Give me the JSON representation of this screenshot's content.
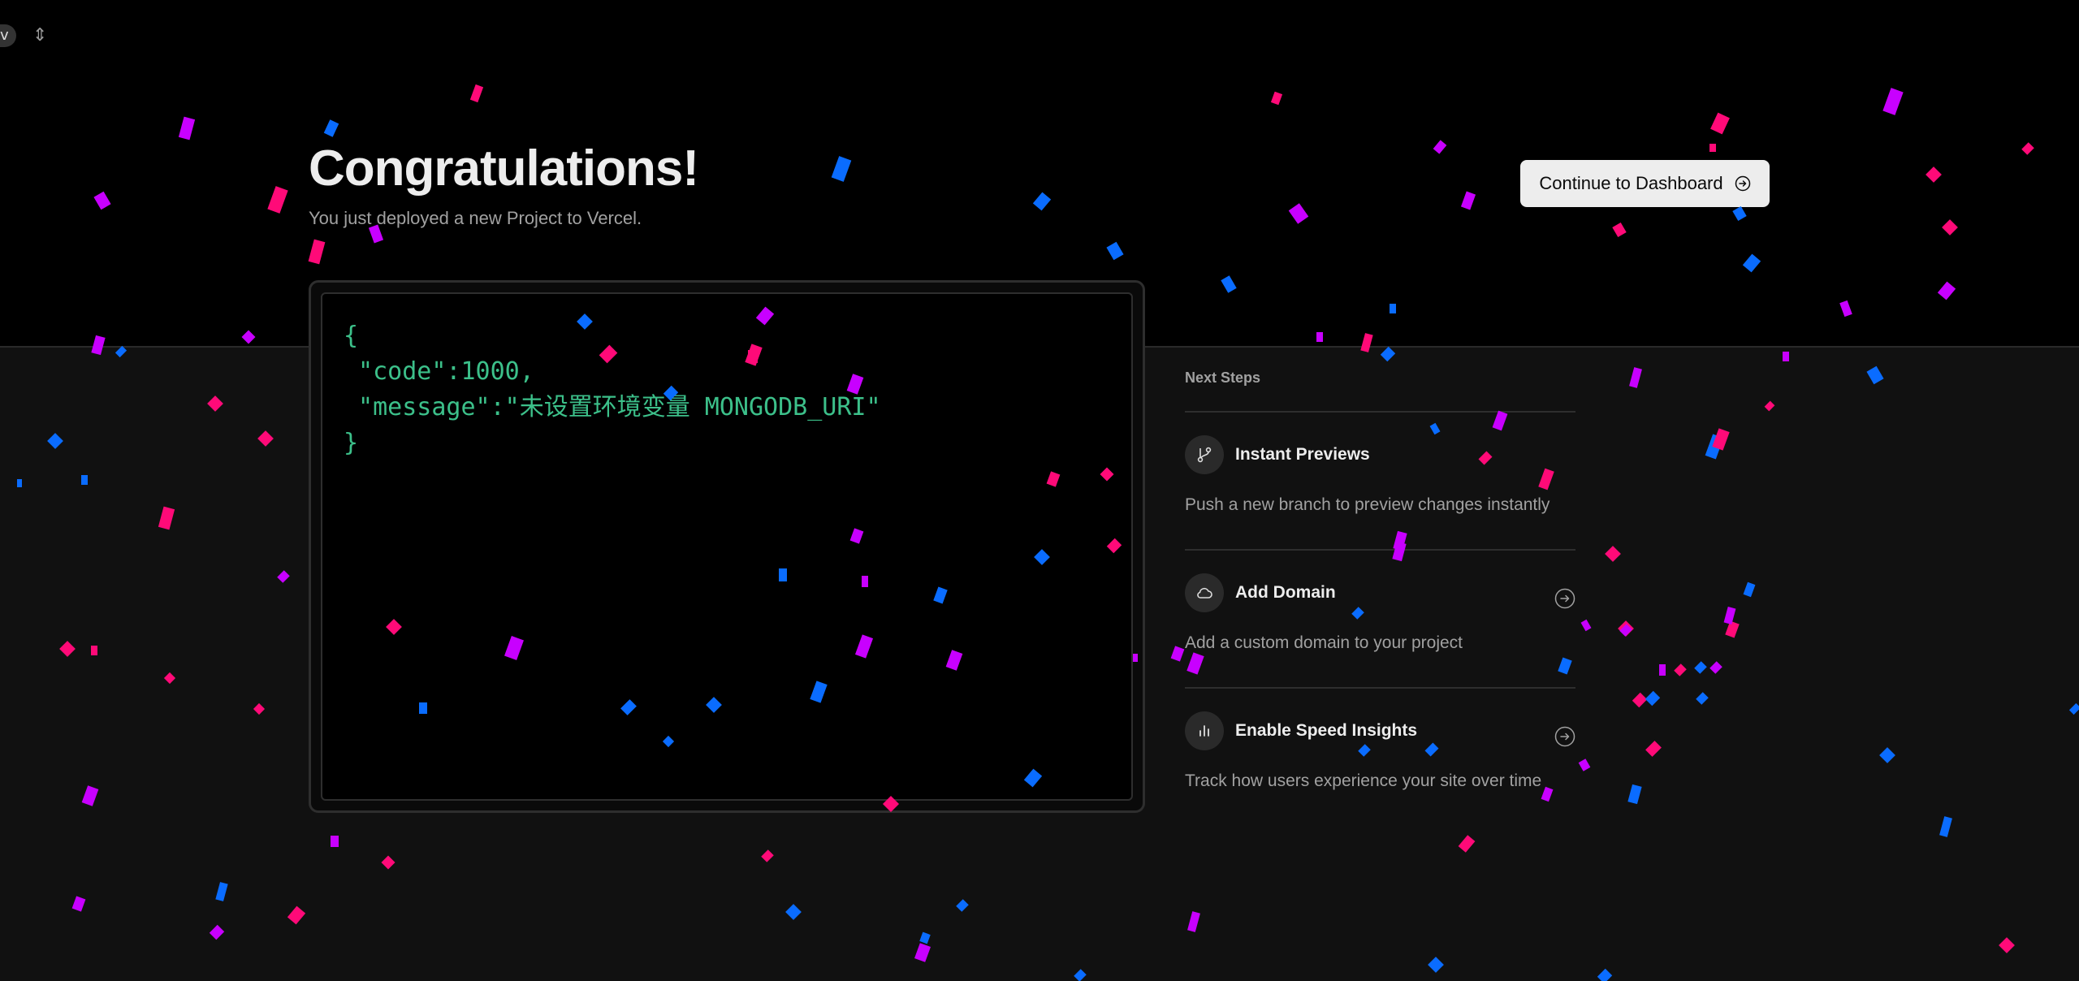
{
  "header": {
    "avatar_initial": "v",
    "switcher_icon": "chevron-up-down-icon",
    "title": "Congratulations!",
    "subtitle": "You just deployed a new Project to Vercel.",
    "cta_label": "Continue to Dashboard",
    "cta_icon": "arrow-right-circle-icon"
  },
  "preview": {
    "code_lines": [
      "{",
      " \"code\":1000,",
      " \"message\":\"未设置环境变量 MONGODB_URI\"",
      "}"
    ]
  },
  "next_steps": {
    "title": "Next Steps",
    "items": [
      {
        "icon": "git-branch-icon",
        "title": "Instant Previews",
        "description": "Push a new branch to preview changes instantly",
        "has_arrow": false
      },
      {
        "icon": "cloud-icon",
        "title": "Add Domain",
        "description": "Add a custom domain to your project",
        "has_arrow": true
      },
      {
        "icon": "bar-chart-icon",
        "title": "Enable Speed Insights",
        "description": "Track how users experience your site over time",
        "has_arrow": true
      }
    ]
  },
  "colors": {
    "confetti": [
      "#ff0a78",
      "#c800ff",
      "#0a6cff"
    ],
    "code_text": "#3cc08a"
  }
}
